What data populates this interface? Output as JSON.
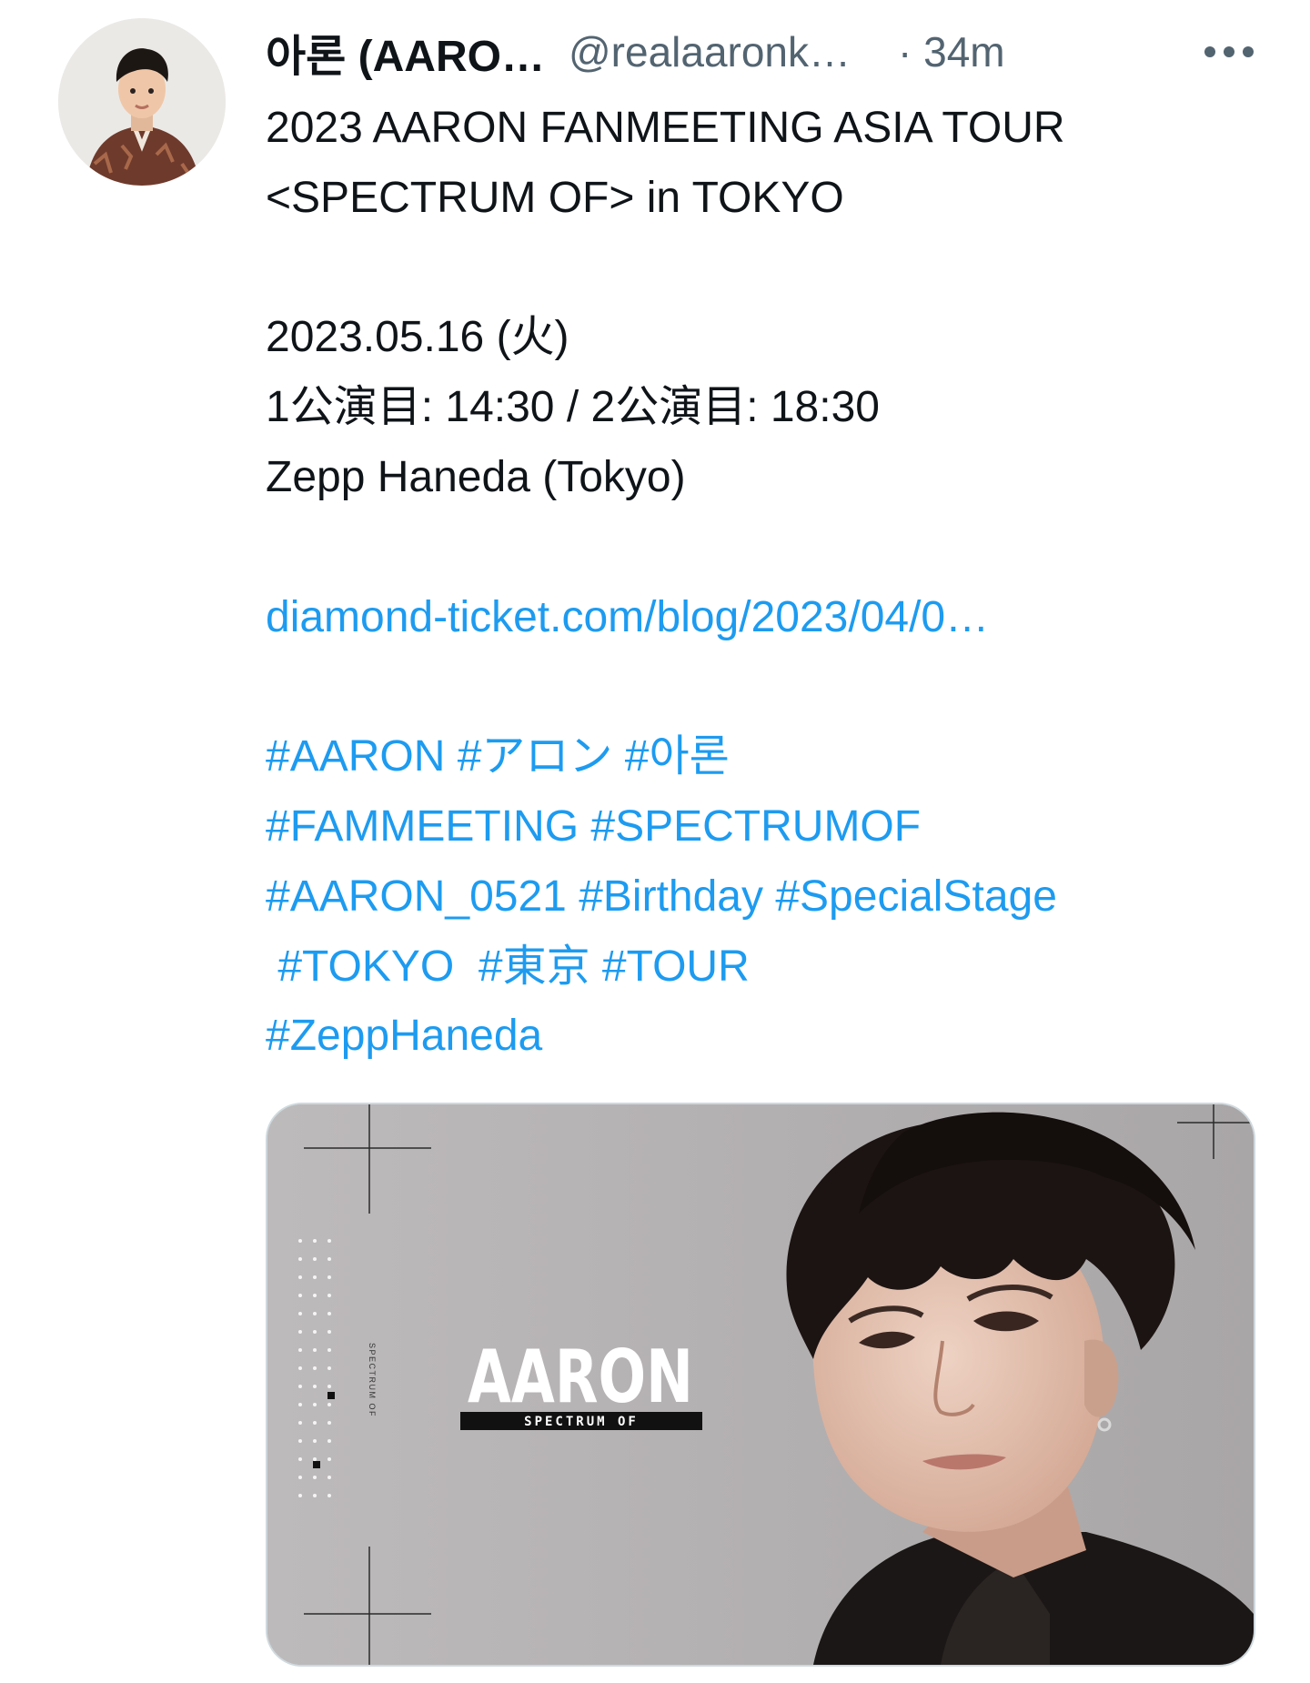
{
  "tweet": {
    "display_name": "아론 (AARO…",
    "handle": "@realaaronk…",
    "time": "· 34m",
    "more_icon": "ellipsis-icon",
    "text": {
      "title_line1": "2023 AARON FANMEETING ASIA TOUR",
      "title_line2": "<SPECTRUM OF> in TOKYO",
      "date_line": "2023.05.16 (火)",
      "times_line": "1公演目: 14:30 / 2公演目: 18:30",
      "venue_line": "Zepp Haneda (Tokyo)",
      "url": "diamond-ticket.com/blog/2023/04/0…",
      "hashtags": [
        "#AARON",
        "#アロン",
        "#아론",
        "#FAMMEETING",
        "#SPECTRUMOF",
        "#AARON_0521",
        "#Birthday",
        "#SpecialStage",
        "#TOKYO",
        "#東京",
        "#TOUR",
        "#ZeppHaneda"
      ]
    },
    "media": {
      "poster_title": "AARON",
      "poster_subtitle": "SPECTRUM OF",
      "vertical_text": "SPECTRUM OF"
    }
  },
  "colors": {
    "link": "#1d9bf0",
    "text": "#0f1419",
    "secondary": "#536471",
    "media_border": "#cfd9de"
  }
}
